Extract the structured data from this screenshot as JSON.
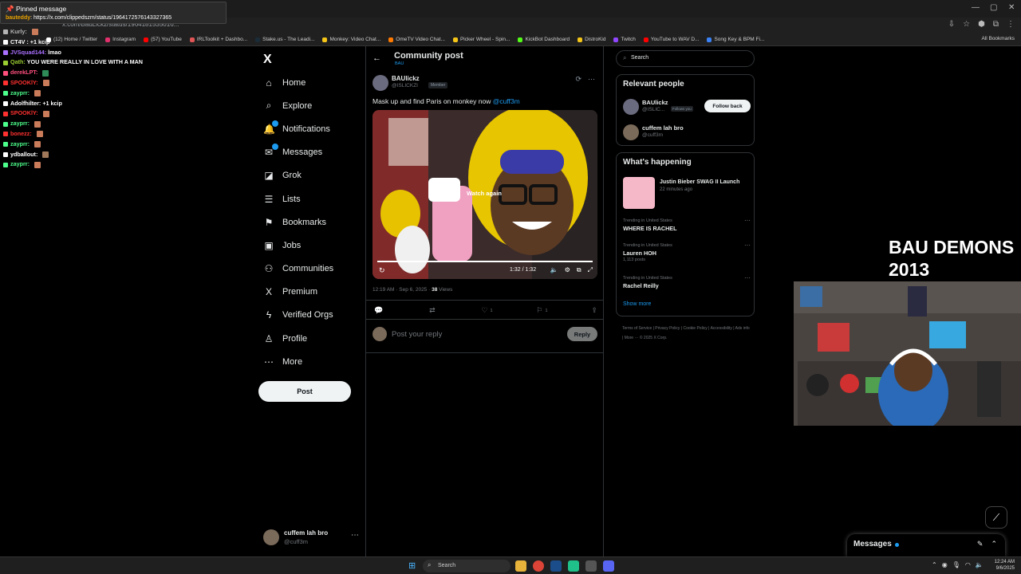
{
  "pinned": {
    "title": "Pinned message",
    "user": "bauteddy",
    "message": ": https://x.com/clippedszm/status/1964172576143327365"
  },
  "chat": [
    {
      "user": "Kurly:",
      "color": "#b4b4b4",
      "text": "",
      "emote": "#c97b5a"
    },
    {
      "user": "CT4V",
      "color": "#ffffff",
      "text": " : +1 kcip",
      "emote": ""
    },
    {
      "user": "JVSquad144:",
      "color": "#a970ff",
      "text": " lmao",
      "emote": ""
    },
    {
      "user": "Qath:",
      "color": "#9acd32",
      "text": " YOU WERE REALLY IN LOVE WITH A MAN",
      "emote": ""
    },
    {
      "user": "derekLPT:",
      "color": "#ff4f7d",
      "text": "",
      "emote": "#2e8b57"
    },
    {
      "user": "SPOOKlY:",
      "color": "#ff3030",
      "text": "",
      "emote": "#c97b5a"
    },
    {
      "user": "zayprr:",
      "color": "#4cff8c",
      "text": "",
      "emote": "#c97b5a"
    },
    {
      "user": "Adolfhilter:",
      "color": "#ffffff",
      "text": " +1 kcip",
      "emote": ""
    },
    {
      "user": "SPOOKlY:",
      "color": "#ff3030",
      "text": "",
      "emote": "#c97b5a"
    },
    {
      "user": "zayprr:",
      "color": "#4cff8c",
      "text": "",
      "emote": "#c97b5a"
    },
    {
      "user": "bonezz:",
      "color": "#ff3030",
      "text": "",
      "emote": "#c97b5a"
    },
    {
      "user": "zayprr:",
      "color": "#4cff8c",
      "text": "",
      "emote": "#c97b5a"
    },
    {
      "user": "ydballout:",
      "color": "#ffffff",
      "text": "",
      "emote": "#a0785a"
    },
    {
      "user": "zayprr:",
      "color": "#4cff8c",
      "text": "",
      "emote": "#c97b5a"
    }
  ],
  "browser": {
    "url": "x.com/BauLickz/status/1964181535016...",
    "bookmarks": [
      {
        "label": "(12) Home / Twitter",
        "color": "#ffffff"
      },
      {
        "label": "Instagram",
        "color": "#e1306c"
      },
      {
        "label": "(57) YouTube",
        "color": "#ff0000"
      },
      {
        "label": "IRLToolkit + Dashbo...",
        "color": "#e05555"
      },
      {
        "label": "Stake.us - The Leadi...",
        "color": "#1a2c38"
      },
      {
        "label": "Monkey: Video Chat...",
        "color": "#f5c518"
      },
      {
        "label": "OmeTV Video Chat...",
        "color": "#ff7a00"
      },
      {
        "label": "Picker Wheel - Spin...",
        "color": "#f5c518"
      },
      {
        "label": "KickBot Dashboard",
        "color": "#53fc18"
      },
      {
        "label": "DistroKid",
        "color": "#f5c518"
      },
      {
        "label": "Twitch",
        "color": "#9146ff"
      },
      {
        "label": "YouTube to WAV D...",
        "color": "#ff0000"
      },
      {
        "label": "Song Key & BPM Fi...",
        "color": "#3b82f6"
      }
    ],
    "all_bookmarks": "All Bookmarks"
  },
  "logo": "X",
  "nav": [
    {
      "icon": "⌂",
      "label": "Home",
      "name": "nav-home",
      "iconName": "home-icon"
    },
    {
      "icon": "⌕",
      "label": "Explore",
      "name": "nav-explore",
      "iconName": "explore-icon"
    },
    {
      "icon": "🔔",
      "label": "Notifications",
      "name": "nav-notifications",
      "iconName": "bell-icon"
    },
    {
      "icon": "✉",
      "label": "Messages",
      "name": "nav-messages",
      "iconName": "mail-icon"
    },
    {
      "icon": "◪",
      "label": "Grok",
      "name": "nav-grok",
      "iconName": "grok-icon"
    },
    {
      "icon": "☰",
      "label": "Lists",
      "name": "nav-lists",
      "iconName": "lists-icon"
    },
    {
      "icon": "⚑",
      "label": "Bookmarks",
      "name": "nav-bookmarks",
      "iconName": "bookmark-icon"
    },
    {
      "icon": "▣",
      "label": "Jobs",
      "name": "nav-jobs",
      "iconName": "briefcase-icon"
    },
    {
      "icon": "⚇",
      "label": "Communities",
      "name": "nav-communities",
      "iconName": "communities-icon"
    },
    {
      "icon": "X",
      "label": "Premium",
      "name": "nav-premium",
      "iconName": "x-icon"
    },
    {
      "icon": "ϟ",
      "label": "Verified Orgs",
      "name": "nav-verified-orgs",
      "iconName": "lightning-icon"
    },
    {
      "icon": "♙",
      "label": "Profile",
      "name": "nav-profile",
      "iconName": "person-icon"
    },
    {
      "icon": "⋯",
      "label": "More",
      "name": "nav-more",
      "iconName": "more-circle-icon"
    }
  ],
  "post_button": "Post",
  "account": {
    "name": "cuffem lah bro",
    "handle": "@cuff3m"
  },
  "main": {
    "title": "Community post",
    "subtitle": "BAU",
    "author": {
      "name": "BAUlickz",
      "handle": "@ISLICKZI",
      "badge": "Member"
    },
    "text": "Mask up and find Paris on monkey now ",
    "mention": "@cuff3m",
    "video": {
      "overlay": "Watch again",
      "time": "1:32 / 1:32",
      "progress": 1.0
    },
    "meta_time": "12:19 AM · Sep 6, 2025 · ",
    "views_count": "38",
    "views_label": " Views",
    "stats": {
      "replies": "",
      "reposts": "",
      "likes": "1",
      "bookmarks": "1"
    },
    "reply_placeholder": "Post your reply",
    "reply_button": "Reply"
  },
  "search": {
    "placeholder": "Search"
  },
  "relevant": {
    "title": "Relevant people",
    "people": [
      {
        "name": "BAUlickz",
        "handle": "@ISLIC...",
        "tag": "Follows you",
        "button": "Follow back"
      },
      {
        "name": "cuffem lah bro",
        "handle": "@cuff3m"
      }
    ]
  },
  "happening": {
    "title": "What's happening",
    "featured": {
      "title": "Justin Bieber SWAG II Launch",
      "time": "22 minutes ago"
    },
    "trends": [
      {
        "context": "Trending in United States",
        "name": "WHERE IS RACHEL",
        "posts": ""
      },
      {
        "context": "Trending in United States",
        "name": "Lauren HOH",
        "posts": "1,113 posts"
      },
      {
        "context": "Trending in United States",
        "name": "Rachel Reilly",
        "posts": ""
      }
    ],
    "show_more": "Show more"
  },
  "footer": "Terms of Service  |  Privacy Policy  |  Cookie Policy  |  Accessibility  |  Ads info  |  More ···  © 2025 X Corp.",
  "overlay_text_1": "BAU DEMONS",
  "overlay_text_2": "2013",
  "messages_drawer": {
    "title": "Messages"
  },
  "taskbar": {
    "search": "Search",
    "time": "12:24 AM",
    "date": "9/6/2025"
  }
}
